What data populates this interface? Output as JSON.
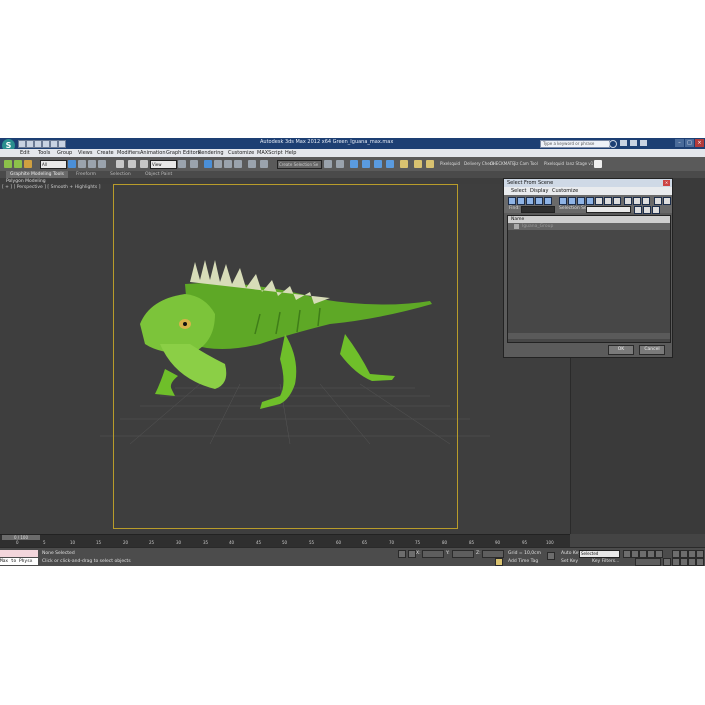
{
  "window": {
    "title": "Autodesk 3ds Max 2012 x64     Green_Iguana_max.max",
    "search_placeholder": "Type a keyword or phrase"
  },
  "menu": [
    "Edit",
    "Tools",
    "Group",
    "Views",
    "Create",
    "Modifiers",
    "Animation",
    "Graph Editors",
    "Rendering",
    "Customize",
    "MAXScript",
    "Help"
  ],
  "toolbar": {
    "filter_value": "All",
    "view_value": "View",
    "selection_set_placeholder": "Create Selection Se",
    "labels": [
      "Pixelsquid",
      "Delivery Check",
      "CHECKMATE",
      "Jiz Cam Tool",
      "Pixelsquid",
      "Ianz Stage v1"
    ]
  },
  "ribbon": {
    "tabs": [
      "Graphite Modeling Tools",
      "Freeform",
      "Selection",
      "Object Paint"
    ],
    "sub_label": "Polygon Modeling"
  },
  "viewport": {
    "label": "[ + ] [ Perspective ] [ Smooth + Highlights ]"
  },
  "select_dialog": {
    "title": "Select From Scene",
    "menu": [
      "Select",
      "Display",
      "Customize"
    ],
    "find_label": "Find:",
    "selection_set_label": "Selection Set:",
    "column_name": "Name",
    "rows": [
      "Iguana_Group"
    ],
    "ok_label": "OK",
    "cancel_label": "Cancel"
  },
  "timeline": {
    "frame_display": "0 / 100",
    "ticks": [
      "0",
      "5",
      "10",
      "15",
      "20",
      "25",
      "30",
      "35",
      "40",
      "45",
      "50",
      "55",
      "60",
      "65",
      "70",
      "75",
      "80",
      "85",
      "90",
      "95",
      "100"
    ]
  },
  "status": {
    "maxscript_text": "Max to Physx",
    "selection_status": "None Selected",
    "prompt": "Click or click-and-drag to select objects",
    "grid": "Grid = 10,0cm",
    "add_time_tag": "Add Time Tag",
    "auto_key": "Auto Key",
    "set_key": "Set Key",
    "selected_value": "Selected",
    "key_filters": "Key Filters...",
    "coord_x": "X:",
    "coord_y": "Y:",
    "coord_z": "Z:"
  },
  "colors": {
    "title_bar": "#1d3f73",
    "viewport_bg": "#3e3e3e",
    "safe_frame": "#b89c2a",
    "iguana_green": "#6fbf2a"
  }
}
